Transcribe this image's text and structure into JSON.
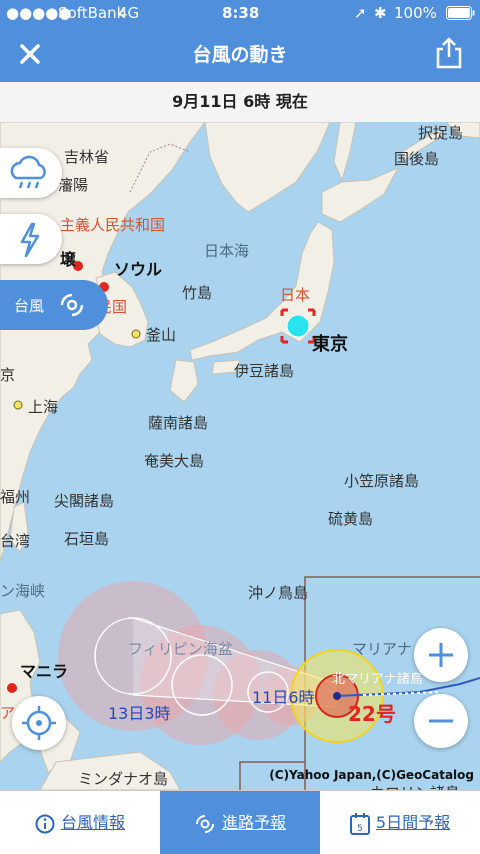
{
  "status_bar": {
    "carrier": "SoftBank",
    "network": "4G",
    "time": "8:38",
    "battery": "100%"
  },
  "header": {
    "title": "台風の動き"
  },
  "date_bar": {
    "text": "9月11日 6時 現在"
  },
  "map": {
    "labels": {
      "etorofu": "択捉島",
      "kunashiri": "国後島",
      "jilin": "吉林省",
      "shenyang": "瀋陽",
      "dprk": "主義人民共和国",
      "pyongyang": "壌",
      "seoul": "ソウル",
      "rok": "韓民国",
      "takeshima": "竹島",
      "sea_of_japan": "日本海",
      "japan": "日本",
      "tokyo": "東京",
      "busan": "釜山",
      "izu": "伊豆諸島",
      "nanjing": "京",
      "shanghai": "上海",
      "satsunan": "薩南諸島",
      "amami": "奄美大島",
      "ogasawara": "小笠原諸島",
      "fujian": "福州",
      "senkaku": "尖閣諸島",
      "taiwan": "台湾",
      "ishigaki": "石垣島",
      "iwoto": "硫黄島",
      "bashi": "ン海峡",
      "okinotori": "沖ノ鳥島",
      "philippine_sea": "フィリピン海盆",
      "mariana": "マリアナ",
      "north_mariana": "北マリアナ諸島",
      "manila": "マニラ",
      "manila_prefix": "ア",
      "mindanao": "ミンダナオ島",
      "caroline": "カロリン諸島",
      "forecast_13": "13日3時",
      "forecast_11": "11日6時",
      "typhoon_number": "22号"
    },
    "credit": "(C)Yahoo Japan,(C)GeoCatalog"
  },
  "controls": {
    "typhoon_tab_label": "台風"
  },
  "tabs": [
    {
      "label": "台風情報",
      "icon": "info-icon"
    },
    {
      "label": "進路予報",
      "icon": "typhoon-icon"
    },
    {
      "label": "5日間予報",
      "icon": "calendar-icon"
    }
  ],
  "colors": {
    "accent": "#4f8fdb",
    "sea": "#a9d3ee",
    "land": "#f2efe6",
    "typhoon": "#e0261d"
  }
}
